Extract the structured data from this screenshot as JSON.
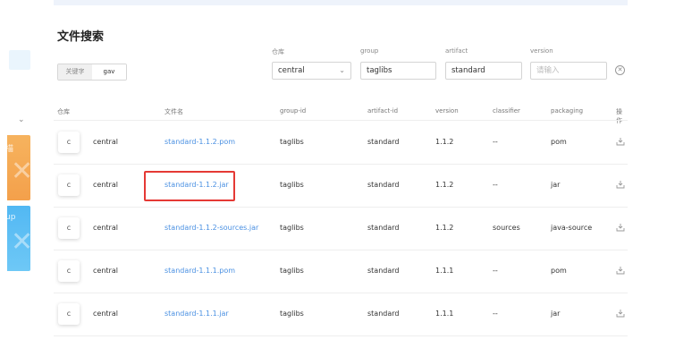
{
  "page": {
    "title": "文件搜索"
  },
  "sidebar": {
    "cards": [
      {
        "text": "描",
        "color": "#f4a64f"
      },
      {
        "text": "up",
        "color": "#5bbcf4"
      }
    ]
  },
  "search": {
    "modes": [
      "关键字",
      "gav"
    ],
    "active_mode": "gav",
    "repo": {
      "label": "仓库",
      "value": "central"
    },
    "group": {
      "label": "group",
      "value": "taglibs"
    },
    "artifact": {
      "label": "artifact",
      "value": "standard"
    },
    "version": {
      "label": "version",
      "placeholder": "请输入"
    }
  },
  "table": {
    "columns": [
      "仓库",
      "文件名",
      "group-id",
      "artifact-id",
      "version",
      "classifier",
      "packaging",
      "操作"
    ],
    "rows": [
      {
        "icon": "c",
        "repo": "central",
        "file": "standard-1.1.2.pom",
        "group": "taglibs",
        "artifact": "standard",
        "version": "1.1.2",
        "classifier": "--",
        "packaging": "pom"
      },
      {
        "icon": "c",
        "repo": "central",
        "file": "standard-1.1.2.jar",
        "group": "taglibs",
        "artifact": "standard",
        "version": "1.1.2",
        "classifier": "--",
        "packaging": "jar"
      },
      {
        "icon": "c",
        "repo": "central",
        "file": "standard-1.1.2-sources.jar",
        "group": "taglibs",
        "artifact": "standard",
        "version": "1.1.2",
        "classifier": "sources",
        "packaging": "java-source"
      },
      {
        "icon": "c",
        "repo": "central",
        "file": "standard-1.1.1.pom",
        "group": "taglibs",
        "artifact": "standard",
        "version": "1.1.1",
        "classifier": "--",
        "packaging": "pom"
      },
      {
        "icon": "c",
        "repo": "central",
        "file": "standard-1.1.1.jar",
        "group": "taglibs",
        "artifact": "standard",
        "version": "1.1.1",
        "classifier": "--",
        "packaging": "jar"
      }
    ],
    "action_icon": "download-icon"
  },
  "colors": {
    "link": "#4a90e2",
    "highlight": "#e53935",
    "orange_card": "#f4a64f",
    "blue_card": "#5bbcf4"
  }
}
